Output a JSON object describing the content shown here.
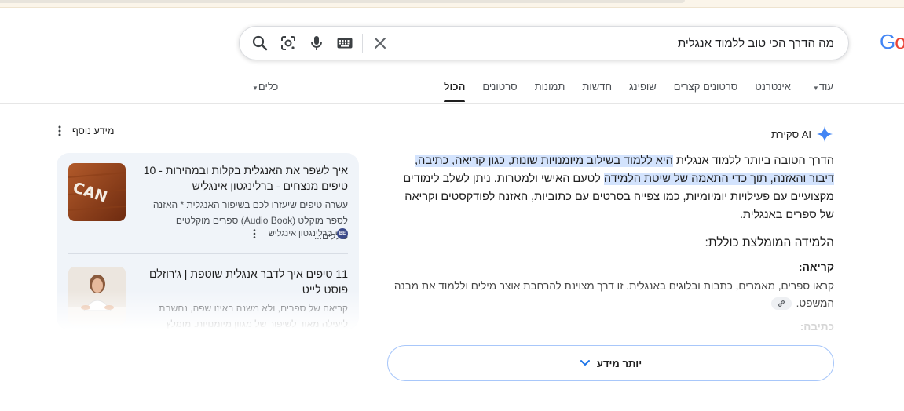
{
  "search": {
    "query": "מה הדרך הכי טוב ללמוד אנגלית",
    "icons": [
      "search-icon",
      "google-lens-icon",
      "microphone-icon",
      "keyboard-icon",
      "close-icon"
    ]
  },
  "logo_text": "Go",
  "tabs": [
    {
      "label": "הכול",
      "active": true
    },
    {
      "label": "סרטונים"
    },
    {
      "label": "תמונות"
    },
    {
      "label": "חדשות"
    },
    {
      "label": "שופינג"
    },
    {
      "label": "סרטונים קצרים"
    },
    {
      "label": "אינטרנט"
    },
    {
      "label": "עוד"
    }
  ],
  "tools_label": "כלים",
  "ai_overview": {
    "label": "סקירת AI",
    "para_start": "הדרך הטובה ביותר ללמוד אנגלית ",
    "para_hl1": "היא ללמוד בשילוב מיומנויות שונות, כגון קריאה, כתיבה, דיבור והאזנה, תוך כדי התאמה של שיטת הלמידה",
    "para_mid": " לטעם האישי ולמטרות. ניתן לשלב לימודים מקצועיים עם פעילויות יומיומיות, כמו צפייה בסרטים עם כתוביות, האזנה לפודקסטים וקריאה של ספרים באנגלית.",
    "subtitle": "הלמידה המומלצת כוללת:",
    "item_title": "קריאה:",
    "item_text": "קראו ספרים, מאמרים, כתבות ובלוגים באנגלית. זו דרך מצוינת להרחבת אוצר מילים וללמוד את מבנה המשפט.",
    "faded_title": "כתיבה:",
    "more_button": "יותר מידע"
  },
  "side": {
    "more_info_label": "מידע נוסף",
    "cards": [
      {
        "title": "איך לשפר את האנגלית בקלות ובמהירות - 10 טיפים מנצחים - ברלינגטון אינגליש",
        "snippet": "עשרה טיפים שיעזרו לכם בשיפור האנגלית * האזנה לספר מוקלט (Audio Book) ספרים מוקלטים כוללים...",
        "source": "ברלינגטון אינגליש",
        "badge": "BE",
        "thumb_text": "CAN"
      },
      {
        "title": "11 טיפים איך לדבר אנגלית שוטפת | ג'רוזלם פוסט לייט",
        "snippet": "קריאה של ספרים, ולא משנה באיזו שפה, נחשבת ליעילה מאוד לשיפור של מגוון מיומנויות. מומלץ לקרוא...",
        "source": "",
        "badge": ""
      }
    ]
  },
  "colors": {
    "accent_blue": "#1a73e8",
    "highlight": "#d3e3fd",
    "panel_bg": "#f0f4f9"
  }
}
